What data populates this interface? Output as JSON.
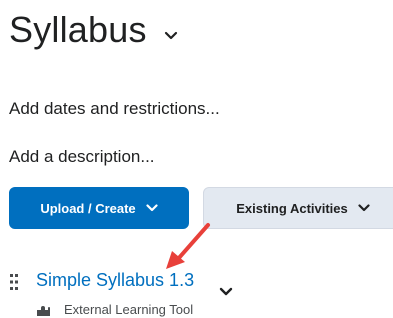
{
  "header": {
    "title": "Syllabus",
    "title_menu_icon": "chevron-down-icon"
  },
  "links": {
    "dates": "Add dates and restrictions...",
    "description": "Add a description..."
  },
  "toolbar": {
    "upload_create_label": "Upload / Create",
    "existing_activities_label": "Existing Activities"
  },
  "content_item": {
    "title": "Simple Syllabus 1.3",
    "type": "External Learning Tool",
    "type_icon": "puzzle-icon",
    "drag_icon": "drag-handle-icon",
    "menu_icon": "chevron-down-icon"
  },
  "colors": {
    "primary": "#006fbf",
    "secondary_bg": "#e3e9f1",
    "text": "#202122",
    "annotation": "#e8403a"
  }
}
